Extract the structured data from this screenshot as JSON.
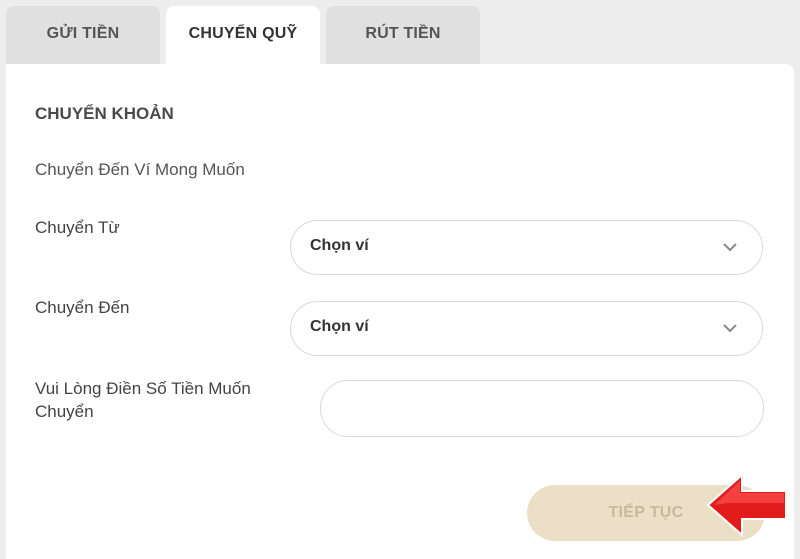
{
  "tabs": [
    {
      "label": "GỬI TIỀN",
      "active": false
    },
    {
      "label": "CHUYỂN QUỸ",
      "active": true
    },
    {
      "label": "RÚT TIỀN",
      "active": false
    }
  ],
  "panel": {
    "section_title": "CHUYỂN KHOẢN",
    "subtitle": "Chuyển Đến Ví Mong Muốn",
    "from_label": "Chuyển Từ",
    "from_select_value": "Chọn ví",
    "to_label": "Chuyển Đến",
    "to_select_value": "Chọn ví",
    "amount_label_line1": "Vui Lòng Điền Số Tiền Muốn",
    "amount_label_line2": "Chuyển",
    "amount_value": "",
    "submit_label": "TIẾP TỤC"
  },
  "colors": {
    "submit_bg": "#ecdfc8",
    "submit_text": "#c9b89a",
    "arrow": "#e31b1b"
  },
  "icons": {
    "select_arrow": "chevron-down-icon",
    "pointer": "red-arrow-pointer-icon"
  }
}
